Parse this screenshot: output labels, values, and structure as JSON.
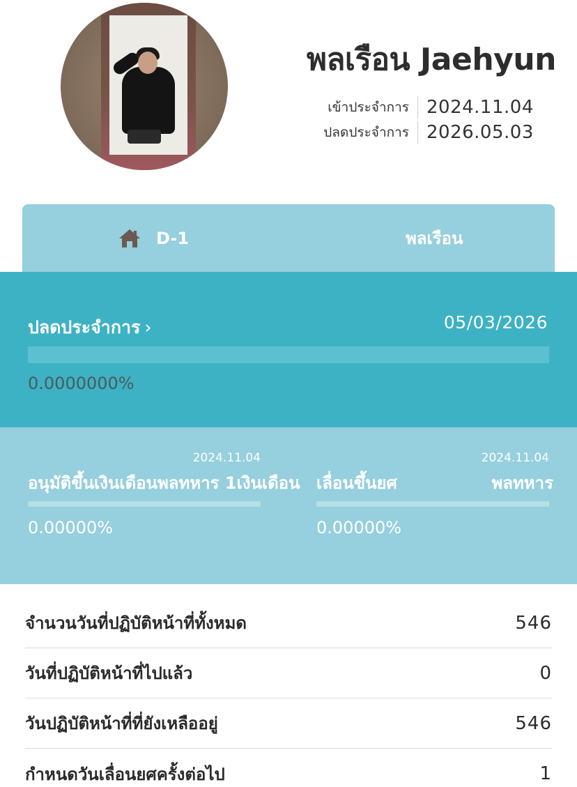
{
  "profile": {
    "name": "พลเรือน Jaehyun",
    "enlist_label": "เข้าประจำการ",
    "enlist_date": "2024.11.04",
    "discharge_label": "ปลดประจำการ",
    "discharge_date": "2026.05.03"
  },
  "tabs": [
    {
      "label": "D-1",
      "icon": "home-icon"
    },
    {
      "label": "พลเรือน"
    }
  ],
  "discharge_progress": {
    "label": "ปลดประจำการ",
    "chevron": "›",
    "date": "05/03/2026",
    "percent_text": "0.0000000%",
    "fraction": 0
  },
  "milestones": [
    {
      "date": "2024.11.04",
      "label": "อนุมัติขึ้นเงินเดือนพลทหาร 1เงินเดือน",
      "percent_text": "0.00000%",
      "fraction": 0
    },
    {
      "date": "2024.11.04",
      "label_prefix": "เลื่อนขึ้นยศ",
      "label": "พลทหาร",
      "percent_text": "0.00000%",
      "fraction": 0
    }
  ],
  "stats": [
    {
      "label": "จำนวนวันที่ปฏิบัติหน้าที่ทั้งหมด",
      "value": "546"
    },
    {
      "label": "วันที่ปฏิบัติหน้าที่ไปแล้ว",
      "value": "0"
    },
    {
      "label": "วันปฏิบัติหน้าที่ที่ยังเหลืออยู่",
      "value": "546"
    },
    {
      "label": "กำหนดวันเลื่อนยศครั้งต่อไป",
      "value": "1"
    }
  ],
  "colors": {
    "tab_bg": "#96cfdd",
    "progress_bg": "#3db2c4",
    "text_dark": "#2d2d2d"
  }
}
